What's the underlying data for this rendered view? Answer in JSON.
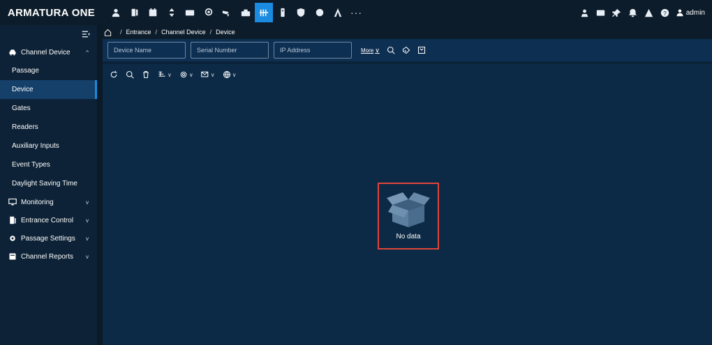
{
  "app": {
    "logo": "ARMATURA ONE",
    "user": "admin"
  },
  "topbar": {
    "modules": [
      {
        "icon": "personnel-icon"
      },
      {
        "icon": "access-door-icon"
      },
      {
        "icon": "attendance-icon"
      },
      {
        "icon": "elevator-icon"
      },
      {
        "icon": "visitor-card-icon"
      },
      {
        "icon": "location-pin-icon"
      },
      {
        "icon": "camera-icon"
      },
      {
        "icon": "patrol-icon"
      },
      {
        "icon": "channel-gate-icon",
        "active": true
      },
      {
        "icon": "intercom-icon"
      },
      {
        "icon": "shield-icon"
      },
      {
        "icon": "badge-icon"
      },
      {
        "icon": "armatura-a-icon"
      },
      {
        "icon": "more-dots-icon"
      }
    ],
    "right_tools": [
      "map-user-icon",
      "id-card-icon",
      "pin-icon",
      "alarm-bell-icon",
      "warning-icon",
      "help-icon"
    ]
  },
  "sidebar": {
    "groups": [
      {
        "label": "Channel Device",
        "icon": "car-icon",
        "expanded": true,
        "items": [
          "Passage",
          "Device",
          "Gates",
          "Readers",
          "Auxiliary Inputs",
          "Event Types",
          "Daylight Saving Time"
        ],
        "active": "Device"
      },
      {
        "label": "Monitoring",
        "icon": "monitor-icon"
      },
      {
        "label": "Entrance Control",
        "icon": "door-icon"
      },
      {
        "label": "Passage Settings",
        "icon": "gear-icon"
      },
      {
        "label": "Channel Reports",
        "icon": "report-icon"
      }
    ]
  },
  "breadcrumb": [
    "Entrance",
    "Channel Device",
    "Device"
  ],
  "filters": {
    "device_name": "Device Name",
    "serial_number": "Serial Number",
    "ip_address": "IP Address",
    "more": "More"
  },
  "empty_state": {
    "text": "No data"
  },
  "colors": {
    "accent": "#1a8be0",
    "highlight_border": "#e0453a",
    "background": "#0c2a46"
  }
}
